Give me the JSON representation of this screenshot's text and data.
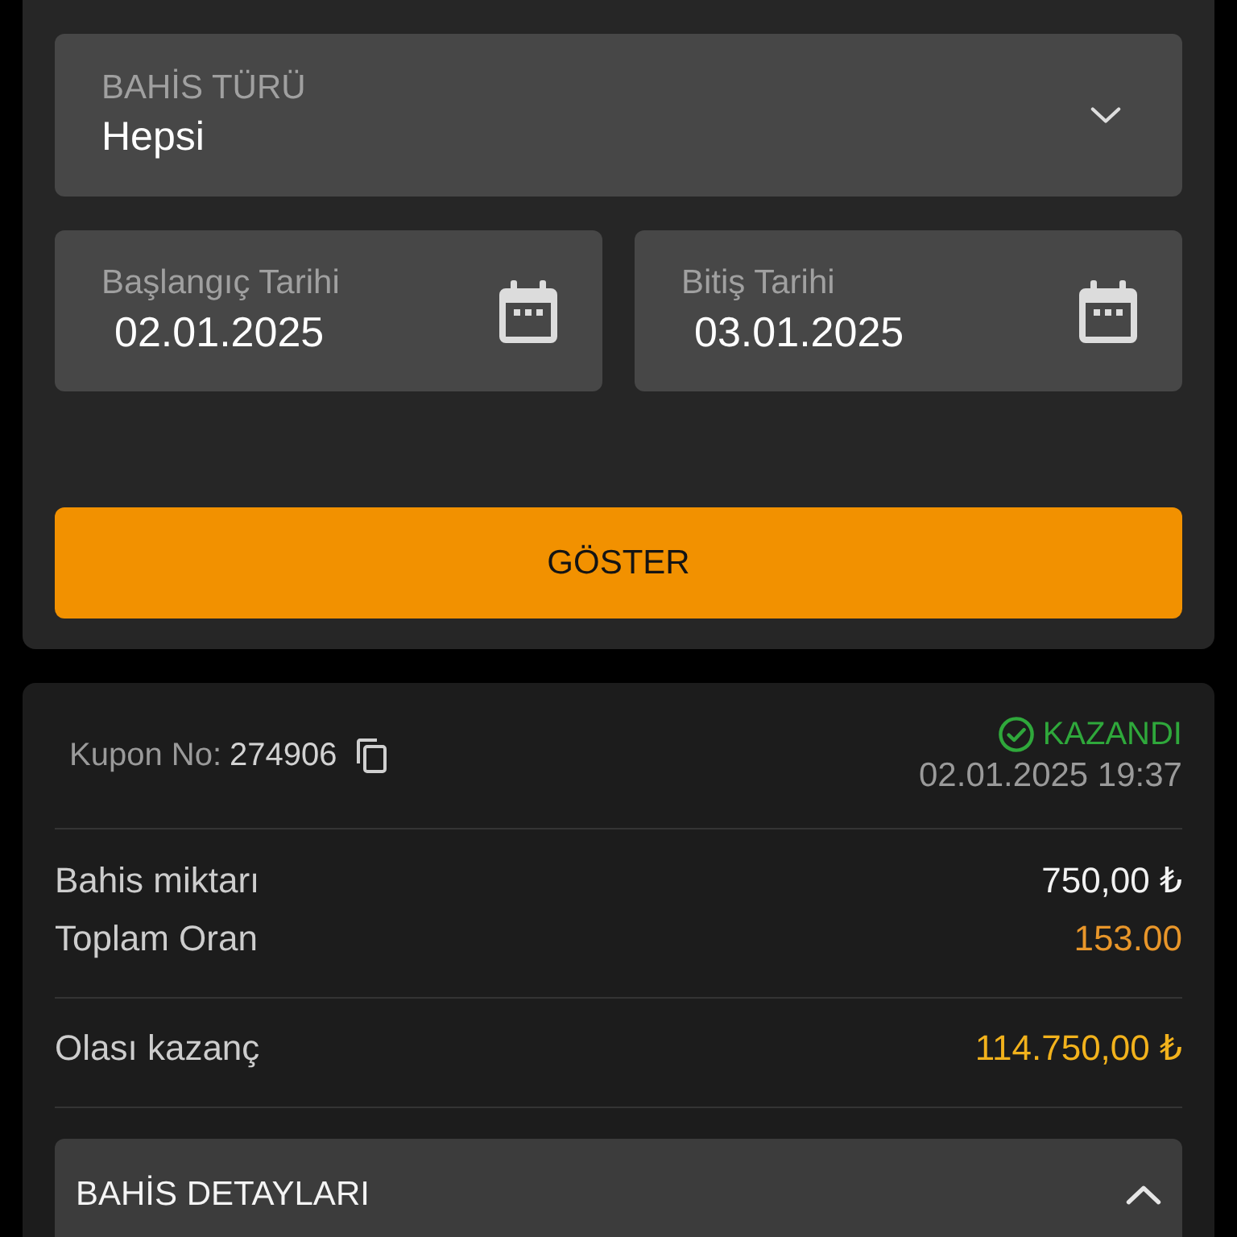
{
  "filter": {
    "bet_type": {
      "label": "BAHİS TÜRÜ",
      "value": "Hepsi",
      "expanded": false
    },
    "dates": [
      {
        "label": "Başlangıç Tarihi",
        "value": "02.01.2025"
      },
      {
        "label": "Bitiş Tarihi",
        "value": "03.01.2025"
      }
    ],
    "show_button": "GÖSTER"
  },
  "coupon": {
    "number_label": "Kupon No:",
    "number": "274906",
    "status": {
      "label": "KAZANDI",
      "kind": "won"
    },
    "date": "02.01.2025 19:37",
    "summary_groups": [
      {
        "rows": [
          {
            "label": "Bahis miktarı",
            "value": "750,00 ₺",
            "kind": "stake"
          },
          {
            "label": "Toplam Oran",
            "value": "153.00",
            "kind": "odds"
          }
        ]
      },
      {
        "rows": [
          {
            "label": "Olası kazanç",
            "value": "114.750,00 ₺",
            "kind": "payout"
          }
        ]
      }
    ],
    "details": {
      "title": "BAHİS DETAYLARI",
      "expanded": true
    }
  }
}
